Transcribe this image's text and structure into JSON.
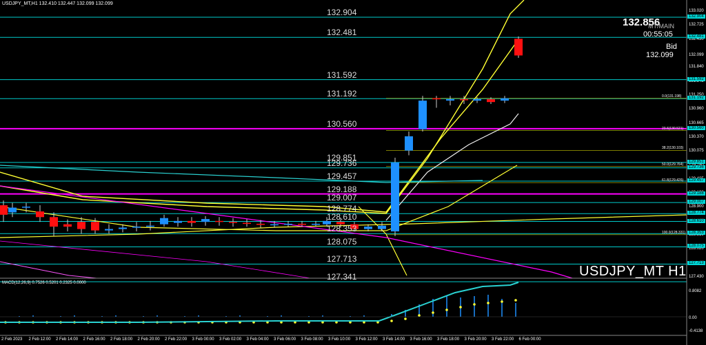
{
  "header": {
    "title": "USDJPY_MT,H1  132.410 132.447 132.099 132.099"
  },
  "info": {
    "current_price": "132.856",
    "symbol_faint": "MT/MAIN",
    "countdown": "00:55:05",
    "bid_label": "Bid",
    "bid_value": "132.099"
  },
  "watermark": "USDJPY_MT H1",
  "macd_label": "MACD(12,26,9) 0.7526 0.5201 0.2325 0.0000",
  "colors": {
    "up": "#1e90ff",
    "down": "#ff1010",
    "level": "#00cccc",
    "magenta": "#ff00ff",
    "yellow": "#ffff33"
  },
  "levels": [
    "132.904",
    "132.481",
    "131.592",
    "131.192",
    "130.560",
    "129.851",
    "129.736",
    "129.457",
    "129.188",
    "129.007",
    "128.774",
    "128.610",
    "128.353",
    "128.075",
    "127.713",
    "127.341"
  ],
  "price_axis": {
    "ticks": [
      "133.020",
      "132.725",
      "132.430",
      "132.099",
      "131.840",
      "131.545",
      "131.250",
      "130.960",
      "130.665",
      "130.370",
      "130.075",
      "129.780",
      "129.485",
      "129.190",
      "128.900",
      "128.605",
      "128.310",
      "128.020",
      "127.725",
      "127.430"
    ],
    "tags": [
      "132.904",
      "132.481",
      "131.592",
      "131.192",
      "130.560",
      "129.851",
      "129.736",
      "129.457",
      "129.188",
      "129.007",
      "128.774",
      "128.610",
      "128.353",
      "128.075",
      "127.713"
    ],
    "macd_ticks": [
      "0.8082",
      "0.00",
      "-0.4138"
    ]
  },
  "fib": [
    "0.0(131.198)",
    "23.6(130.521)",
    "38.2(130.103)",
    "50.0(129.764)",
    "61.8(129.426)",
    "100.0(128.331)"
  ],
  "time_axis": [
    "2 Feb 2023",
    "2 Feb 12:00",
    "2 Feb 14:00",
    "2 Feb 16:00",
    "2 Feb 18:00",
    "2 Feb 20:00",
    "2 Feb 22:00",
    "3 Feb 00:00",
    "3 Feb 02:00",
    "3 Feb 04:00",
    "3 Feb 06:00",
    "3 Feb 08:00",
    "3 Feb 10:00",
    "3 Feb 12:00",
    "3 Feb 14:00",
    "3 Feb 16:00",
    "3 Feb 18:00",
    "3 Feb 20:00",
    "3 Feb 22:00",
    "6 Feb 00:00"
  ]
}
